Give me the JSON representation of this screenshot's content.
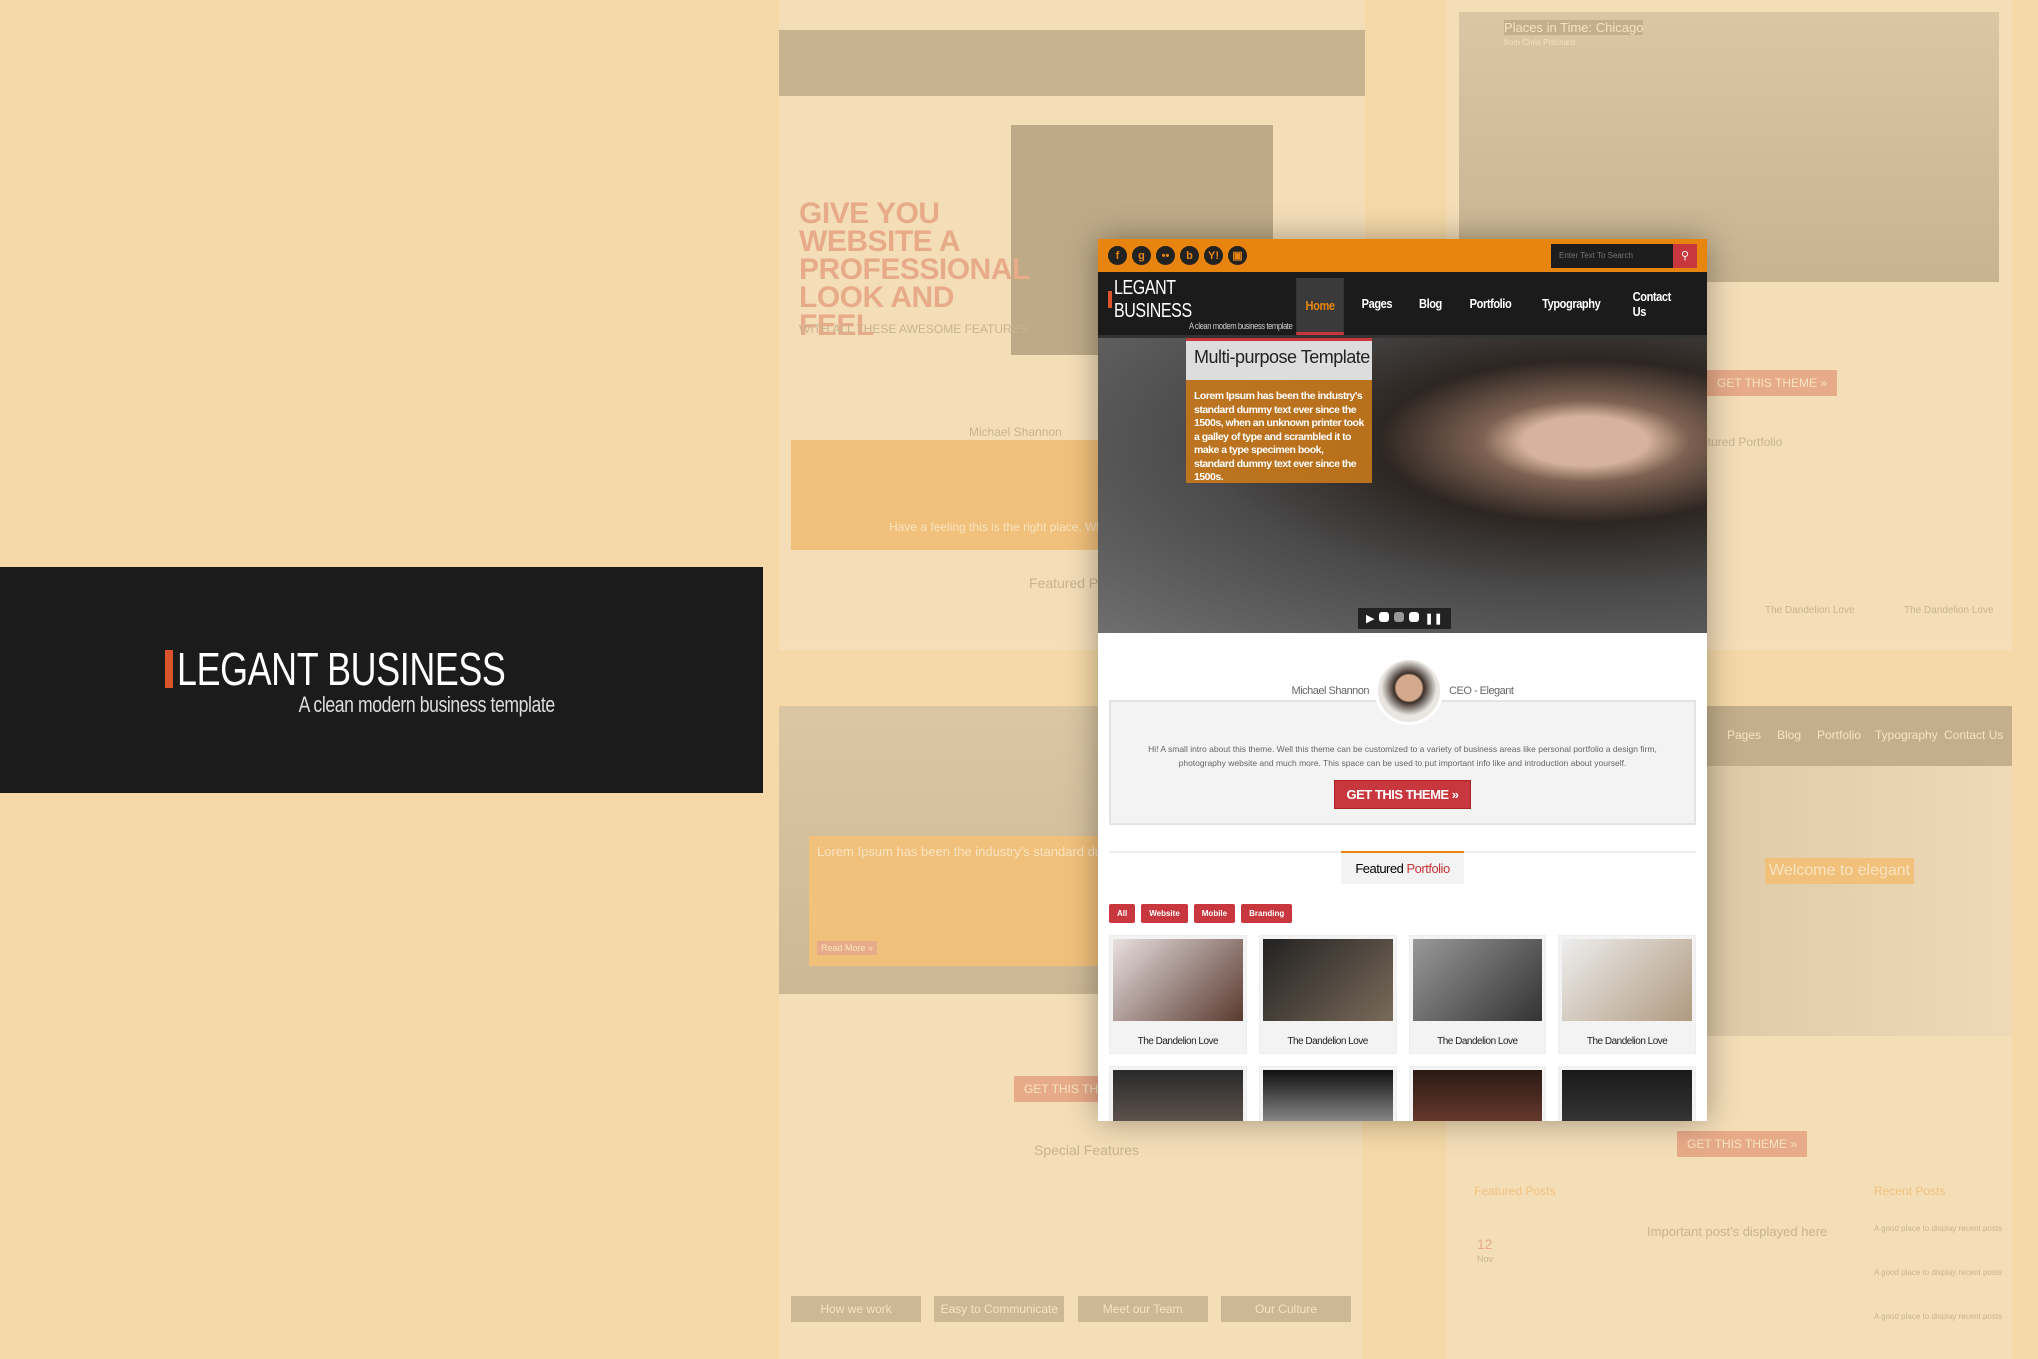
{
  "promo": {
    "logo_title": "LEGANT BUSINESS",
    "logo_tagline": "A clean modern business template"
  },
  "background_mockups": {
    "top_left": {
      "headline": "GIVE YOU WEBSITE A PROFESSIONAL LOOK AND FEEL",
      "subhead": "WITH ALL THESE AWESOME FEATURES",
      "person": "Michael Shannon",
      "feeling": "Have a feeling this is the right place. Why the",
      "featured": "Featured Portfolio"
    },
    "top_right": {
      "video_title": "Places in Time: Chicago",
      "video_author": "from Chris Pritchard",
      "cta": "GET THIS THEME »",
      "featured": "Featured Portfolio",
      "items": [
        "The Dandelion Love",
        "The Dandelion Love"
      ]
    },
    "bottom_left": {
      "caption": "Lorem Ipsum has been the industry's standard dummy text.",
      "read_more": "Read More »",
      "cta": "GET THIS THEME »",
      "section": "Special Features",
      "features": [
        "How we work",
        "Easy to Communicate",
        "Meet our Team",
        "Our Culture"
      ]
    },
    "bottom_right": {
      "nav": [
        "Pages",
        "Blog",
        "Portfolio",
        "Typography",
        "Contact Us"
      ],
      "welcome": "Welcome to elegant",
      "cta": "GET THIS THEME »",
      "featured_posts": "Featured Posts",
      "recent_posts": "Recent Posts",
      "post_title": "Important post's displayed here",
      "date_day": "12",
      "date_month": "Nov",
      "recent": [
        "A good place to display recent posts",
        "A good place to display recent posts",
        "A good place to display recent posts"
      ]
    }
  },
  "site": {
    "social_icons": [
      "facebook-icon",
      "google-plus-icon",
      "flickr-icon",
      "blogger-icon",
      "yahoo-icon",
      "youtube-icon"
    ],
    "social_glyphs": [
      "f",
      "g",
      "••",
      "b",
      "Y!",
      "▣"
    ],
    "search_placeholder": "Enter Text To Search",
    "logo_title": "LEGANT BUSINESS",
    "logo_tagline": "A clean modern business template",
    "nav": [
      "Home",
      "Pages",
      "Blog",
      "Portfolio",
      "Typography",
      "Contact Us"
    ],
    "active_nav": "Home",
    "slider": {
      "title": "Multi-purpose Template",
      "text": "Lorem Ipsum has been the industry's standard dummy text ever since the 1500s, when an unknown printer took a galley of type and scrambled it to make a type specimen book, standard dummy text ever since the 1500s.",
      "slides": 3,
      "current": 2
    },
    "testimonial": {
      "name": "Michael Shannon",
      "role": "CEO - Elegant",
      "text": "Hi! A small intro about this theme. Well this theme can be customized to a variety of business areas like personal portfolio a design firm, photography website and much more. This space can be used to put important info like and introduction about yourself.",
      "cta": "GET THIS THEME »"
    },
    "portfolio": {
      "title_a": "Featured",
      "title_b": "Portfolio",
      "filters": [
        "All",
        "Website",
        "Mobile",
        "Branding"
      ],
      "items": [
        "The Dandelion Love",
        "The Dandelion Love",
        "The Dandelion Love",
        "The Dandelion Love"
      ]
    }
  },
  "colors": {
    "accent": "#e8850f",
    "red": "#c7373d",
    "dark": "#1b1b1b",
    "background": "#f5d9a8"
  }
}
